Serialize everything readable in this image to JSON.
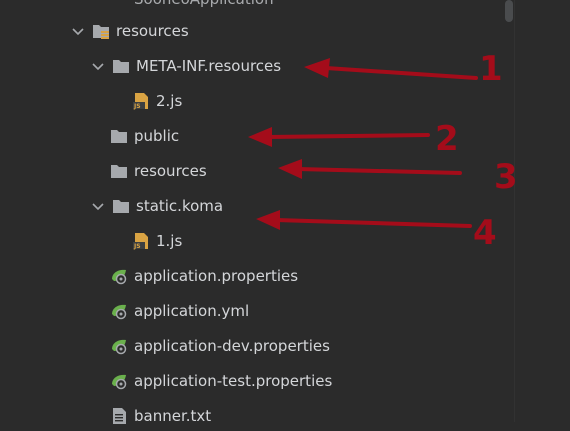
{
  "tree": {
    "top_item": "SooneoApplication",
    "resources_folder": "resources",
    "meta_inf_folder": "META-INF.resources",
    "file_2js": "2.js",
    "public_folder": "public",
    "resources_sub_folder": "resources",
    "static_folder": "static.koma",
    "file_1js": "1.js",
    "app_properties": "application.properties",
    "app_yml": "application.yml",
    "app_dev": "application-dev.properties",
    "app_test": "application-test.properties",
    "banner": "banner.txt"
  },
  "annotations": {
    "n1": "1",
    "n2": "2",
    "n3": "3",
    "n4": "4"
  },
  "colors": {
    "background": "#2b2b2b",
    "text": "#d4d6d9",
    "folder": "#a6a9ad",
    "annotation": "#a40c1a"
  }
}
